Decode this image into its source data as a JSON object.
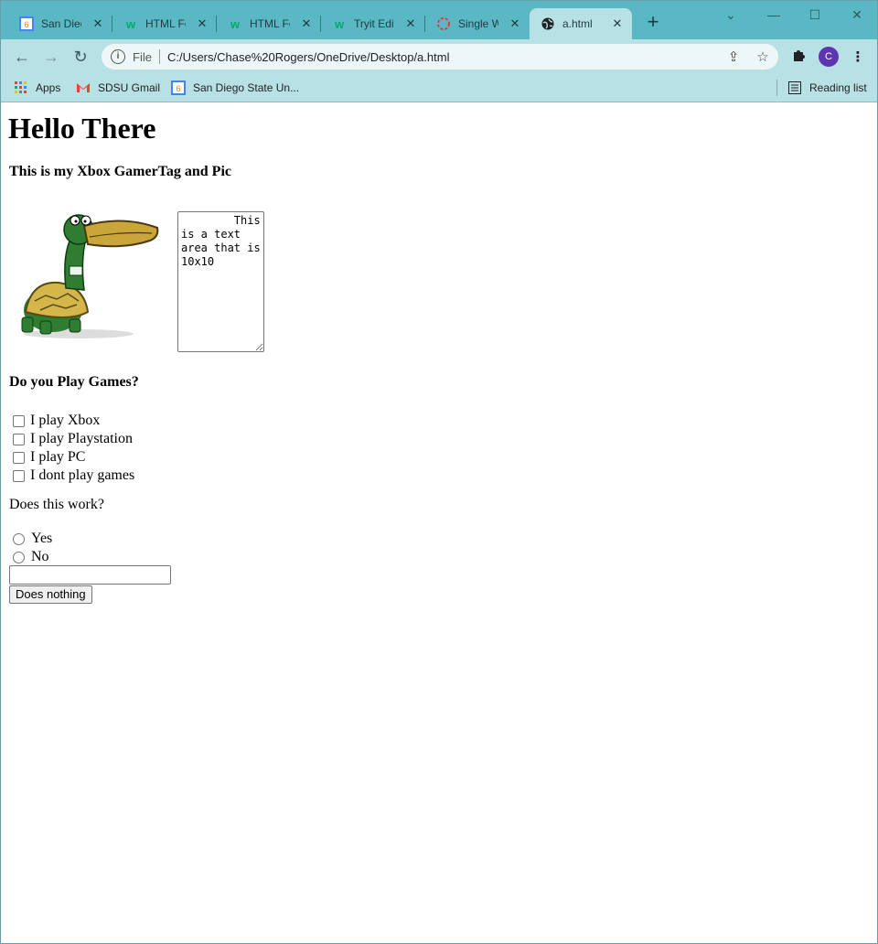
{
  "browser": {
    "tabs": [
      {
        "title": "San Diego State University",
        "icon": "sdsu-favicon-icon"
      },
      {
        "title": "HTML Forms",
        "icon": "w3schools-icon"
      },
      {
        "title": "HTML Forms",
        "icon": "w3schools-icon"
      },
      {
        "title": "Tryit Editor",
        "icon": "w3schools-icon"
      },
      {
        "title": "Single Web Page",
        "icon": "spinner-icon"
      },
      {
        "title": "a.html",
        "icon": "globe-icon",
        "active": true
      }
    ],
    "address": {
      "scheme": "File",
      "url": "C:/Users/Chase%20Rogers/OneDrive/Desktop/a.html"
    },
    "profile_initial": "C",
    "bookmarks": [
      {
        "label": "Apps",
        "icon": "apps-grid-icon"
      },
      {
        "label": "SDSU Gmail",
        "icon": "gmail-icon"
      },
      {
        "label": "San Diego State Un...",
        "icon": "sdsu-favicon-icon"
      }
    ],
    "reading_list": "Reading list"
  },
  "page": {
    "heading": "Hello There",
    "subheading": "This is my Xbox GamerTag and Pic",
    "textarea_value": "        This is a text area that is 10x10",
    "games_question": "Do you Play Games?",
    "checkboxes": [
      "I play Xbox",
      "I play Playstation",
      "I play PC",
      "I dont play games"
    ],
    "works_question": "Does this work?",
    "radios": [
      "Yes",
      "No"
    ],
    "text_input_value": "",
    "button_label": "Does nothing"
  },
  "colors": {
    "tabstrip": "#5ab8c4",
    "toolbar": "#b8e1e6",
    "avatar": "#5e35b1"
  }
}
